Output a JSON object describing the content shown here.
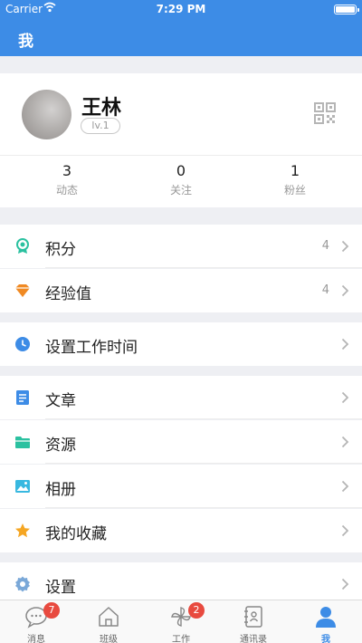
{
  "status": {
    "carrier": "Carrier",
    "time": "7:29 PM"
  },
  "header": {
    "title": "我"
  },
  "profile": {
    "name": "王林",
    "level": "lv.1",
    "stats": [
      {
        "num": "3",
        "label": "动态"
      },
      {
        "num": "0",
        "label": "关注"
      },
      {
        "num": "1",
        "label": "粉丝"
      }
    ]
  },
  "menu": {
    "points": {
      "label": "积分",
      "value": "4"
    },
    "exp": {
      "label": "经验值",
      "value": "4"
    },
    "worktime": {
      "label": "设置工作时间"
    },
    "articles": {
      "label": "文章"
    },
    "resources": {
      "label": "资源"
    },
    "album": {
      "label": "相册"
    },
    "favorites": {
      "label": "我的收藏"
    },
    "settings": {
      "label": "设置"
    }
  },
  "tabs": [
    {
      "label": "消息",
      "badge": "7"
    },
    {
      "label": "班级"
    },
    {
      "label": "工作",
      "badge": "2"
    },
    {
      "label": "通讯录"
    },
    {
      "label": "我"
    }
  ],
  "colors": {
    "primary": "#3d8ce6",
    "badge": "#e84a3f",
    "points": "#2bc1a0",
    "exp": "#f08a24",
    "star": "#f5a623"
  }
}
